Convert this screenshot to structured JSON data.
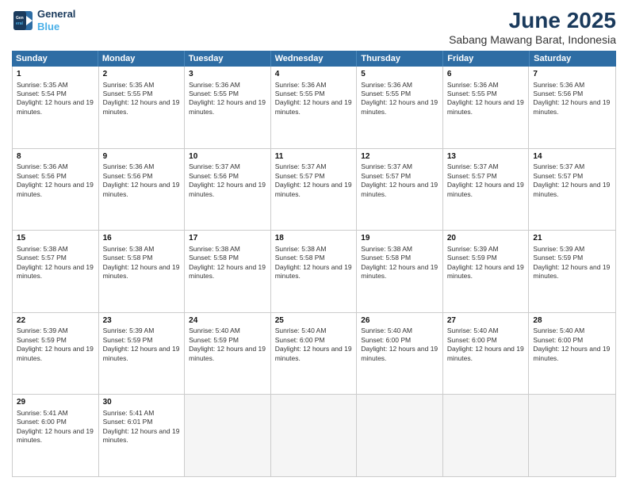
{
  "logo": {
    "line1": "General",
    "line2": "Blue"
  },
  "title": "June 2025",
  "subtitle": "Sabang Mawang Barat, Indonesia",
  "days": [
    "Sunday",
    "Monday",
    "Tuesday",
    "Wednesday",
    "Thursday",
    "Friday",
    "Saturday"
  ],
  "rows": [
    [
      {
        "day": "1",
        "sunrise": "Sunrise: 5:35 AM",
        "sunset": "Sunset: 5:54 PM",
        "daylight": "Daylight: 12 hours and 19 minutes."
      },
      {
        "day": "2",
        "sunrise": "Sunrise: 5:35 AM",
        "sunset": "Sunset: 5:55 PM",
        "daylight": "Daylight: 12 hours and 19 minutes."
      },
      {
        "day": "3",
        "sunrise": "Sunrise: 5:36 AM",
        "sunset": "Sunset: 5:55 PM",
        "daylight": "Daylight: 12 hours and 19 minutes."
      },
      {
        "day": "4",
        "sunrise": "Sunrise: 5:36 AM",
        "sunset": "Sunset: 5:55 PM",
        "daylight": "Daylight: 12 hours and 19 minutes."
      },
      {
        "day": "5",
        "sunrise": "Sunrise: 5:36 AM",
        "sunset": "Sunset: 5:55 PM",
        "daylight": "Daylight: 12 hours and 19 minutes."
      },
      {
        "day": "6",
        "sunrise": "Sunrise: 5:36 AM",
        "sunset": "Sunset: 5:55 PM",
        "daylight": "Daylight: 12 hours and 19 minutes."
      },
      {
        "day": "7",
        "sunrise": "Sunrise: 5:36 AM",
        "sunset": "Sunset: 5:56 PM",
        "daylight": "Daylight: 12 hours and 19 minutes."
      }
    ],
    [
      {
        "day": "8",
        "sunrise": "Sunrise: 5:36 AM",
        "sunset": "Sunset: 5:56 PM",
        "daylight": "Daylight: 12 hours and 19 minutes."
      },
      {
        "day": "9",
        "sunrise": "Sunrise: 5:36 AM",
        "sunset": "Sunset: 5:56 PM",
        "daylight": "Daylight: 12 hours and 19 minutes."
      },
      {
        "day": "10",
        "sunrise": "Sunrise: 5:37 AM",
        "sunset": "Sunset: 5:56 PM",
        "daylight": "Daylight: 12 hours and 19 minutes."
      },
      {
        "day": "11",
        "sunrise": "Sunrise: 5:37 AM",
        "sunset": "Sunset: 5:57 PM",
        "daylight": "Daylight: 12 hours and 19 minutes."
      },
      {
        "day": "12",
        "sunrise": "Sunrise: 5:37 AM",
        "sunset": "Sunset: 5:57 PM",
        "daylight": "Daylight: 12 hours and 19 minutes."
      },
      {
        "day": "13",
        "sunrise": "Sunrise: 5:37 AM",
        "sunset": "Sunset: 5:57 PM",
        "daylight": "Daylight: 12 hours and 19 minutes."
      },
      {
        "day": "14",
        "sunrise": "Sunrise: 5:37 AM",
        "sunset": "Sunset: 5:57 PM",
        "daylight": "Daylight: 12 hours and 19 minutes."
      }
    ],
    [
      {
        "day": "15",
        "sunrise": "Sunrise: 5:38 AM",
        "sunset": "Sunset: 5:57 PM",
        "daylight": "Daylight: 12 hours and 19 minutes."
      },
      {
        "day": "16",
        "sunrise": "Sunrise: 5:38 AM",
        "sunset": "Sunset: 5:58 PM",
        "daylight": "Daylight: 12 hours and 19 minutes."
      },
      {
        "day": "17",
        "sunrise": "Sunrise: 5:38 AM",
        "sunset": "Sunset: 5:58 PM",
        "daylight": "Daylight: 12 hours and 19 minutes."
      },
      {
        "day": "18",
        "sunrise": "Sunrise: 5:38 AM",
        "sunset": "Sunset: 5:58 PM",
        "daylight": "Daylight: 12 hours and 19 minutes."
      },
      {
        "day": "19",
        "sunrise": "Sunrise: 5:38 AM",
        "sunset": "Sunset: 5:58 PM",
        "daylight": "Daylight: 12 hours and 19 minutes."
      },
      {
        "day": "20",
        "sunrise": "Sunrise: 5:39 AM",
        "sunset": "Sunset: 5:59 PM",
        "daylight": "Daylight: 12 hours and 19 minutes."
      },
      {
        "day": "21",
        "sunrise": "Sunrise: 5:39 AM",
        "sunset": "Sunset: 5:59 PM",
        "daylight": "Daylight: 12 hours and 19 minutes."
      }
    ],
    [
      {
        "day": "22",
        "sunrise": "Sunrise: 5:39 AM",
        "sunset": "Sunset: 5:59 PM",
        "daylight": "Daylight: 12 hours and 19 minutes."
      },
      {
        "day": "23",
        "sunrise": "Sunrise: 5:39 AM",
        "sunset": "Sunset: 5:59 PM",
        "daylight": "Daylight: 12 hours and 19 minutes."
      },
      {
        "day": "24",
        "sunrise": "Sunrise: 5:40 AM",
        "sunset": "Sunset: 5:59 PM",
        "daylight": "Daylight: 12 hours and 19 minutes."
      },
      {
        "day": "25",
        "sunrise": "Sunrise: 5:40 AM",
        "sunset": "Sunset: 6:00 PM",
        "daylight": "Daylight: 12 hours and 19 minutes."
      },
      {
        "day": "26",
        "sunrise": "Sunrise: 5:40 AM",
        "sunset": "Sunset: 6:00 PM",
        "daylight": "Daylight: 12 hours and 19 minutes."
      },
      {
        "day": "27",
        "sunrise": "Sunrise: 5:40 AM",
        "sunset": "Sunset: 6:00 PM",
        "daylight": "Daylight: 12 hours and 19 minutes."
      },
      {
        "day": "28",
        "sunrise": "Sunrise: 5:40 AM",
        "sunset": "Sunset: 6:00 PM",
        "daylight": "Daylight: 12 hours and 19 minutes."
      }
    ],
    [
      {
        "day": "29",
        "sunrise": "Sunrise: 5:41 AM",
        "sunset": "Sunset: 6:00 PM",
        "daylight": "Daylight: 12 hours and 19 minutes."
      },
      {
        "day": "30",
        "sunrise": "Sunrise: 5:41 AM",
        "sunset": "Sunset: 6:01 PM",
        "daylight": "Daylight: 12 hours and 19 minutes."
      },
      null,
      null,
      null,
      null,
      null
    ]
  ]
}
